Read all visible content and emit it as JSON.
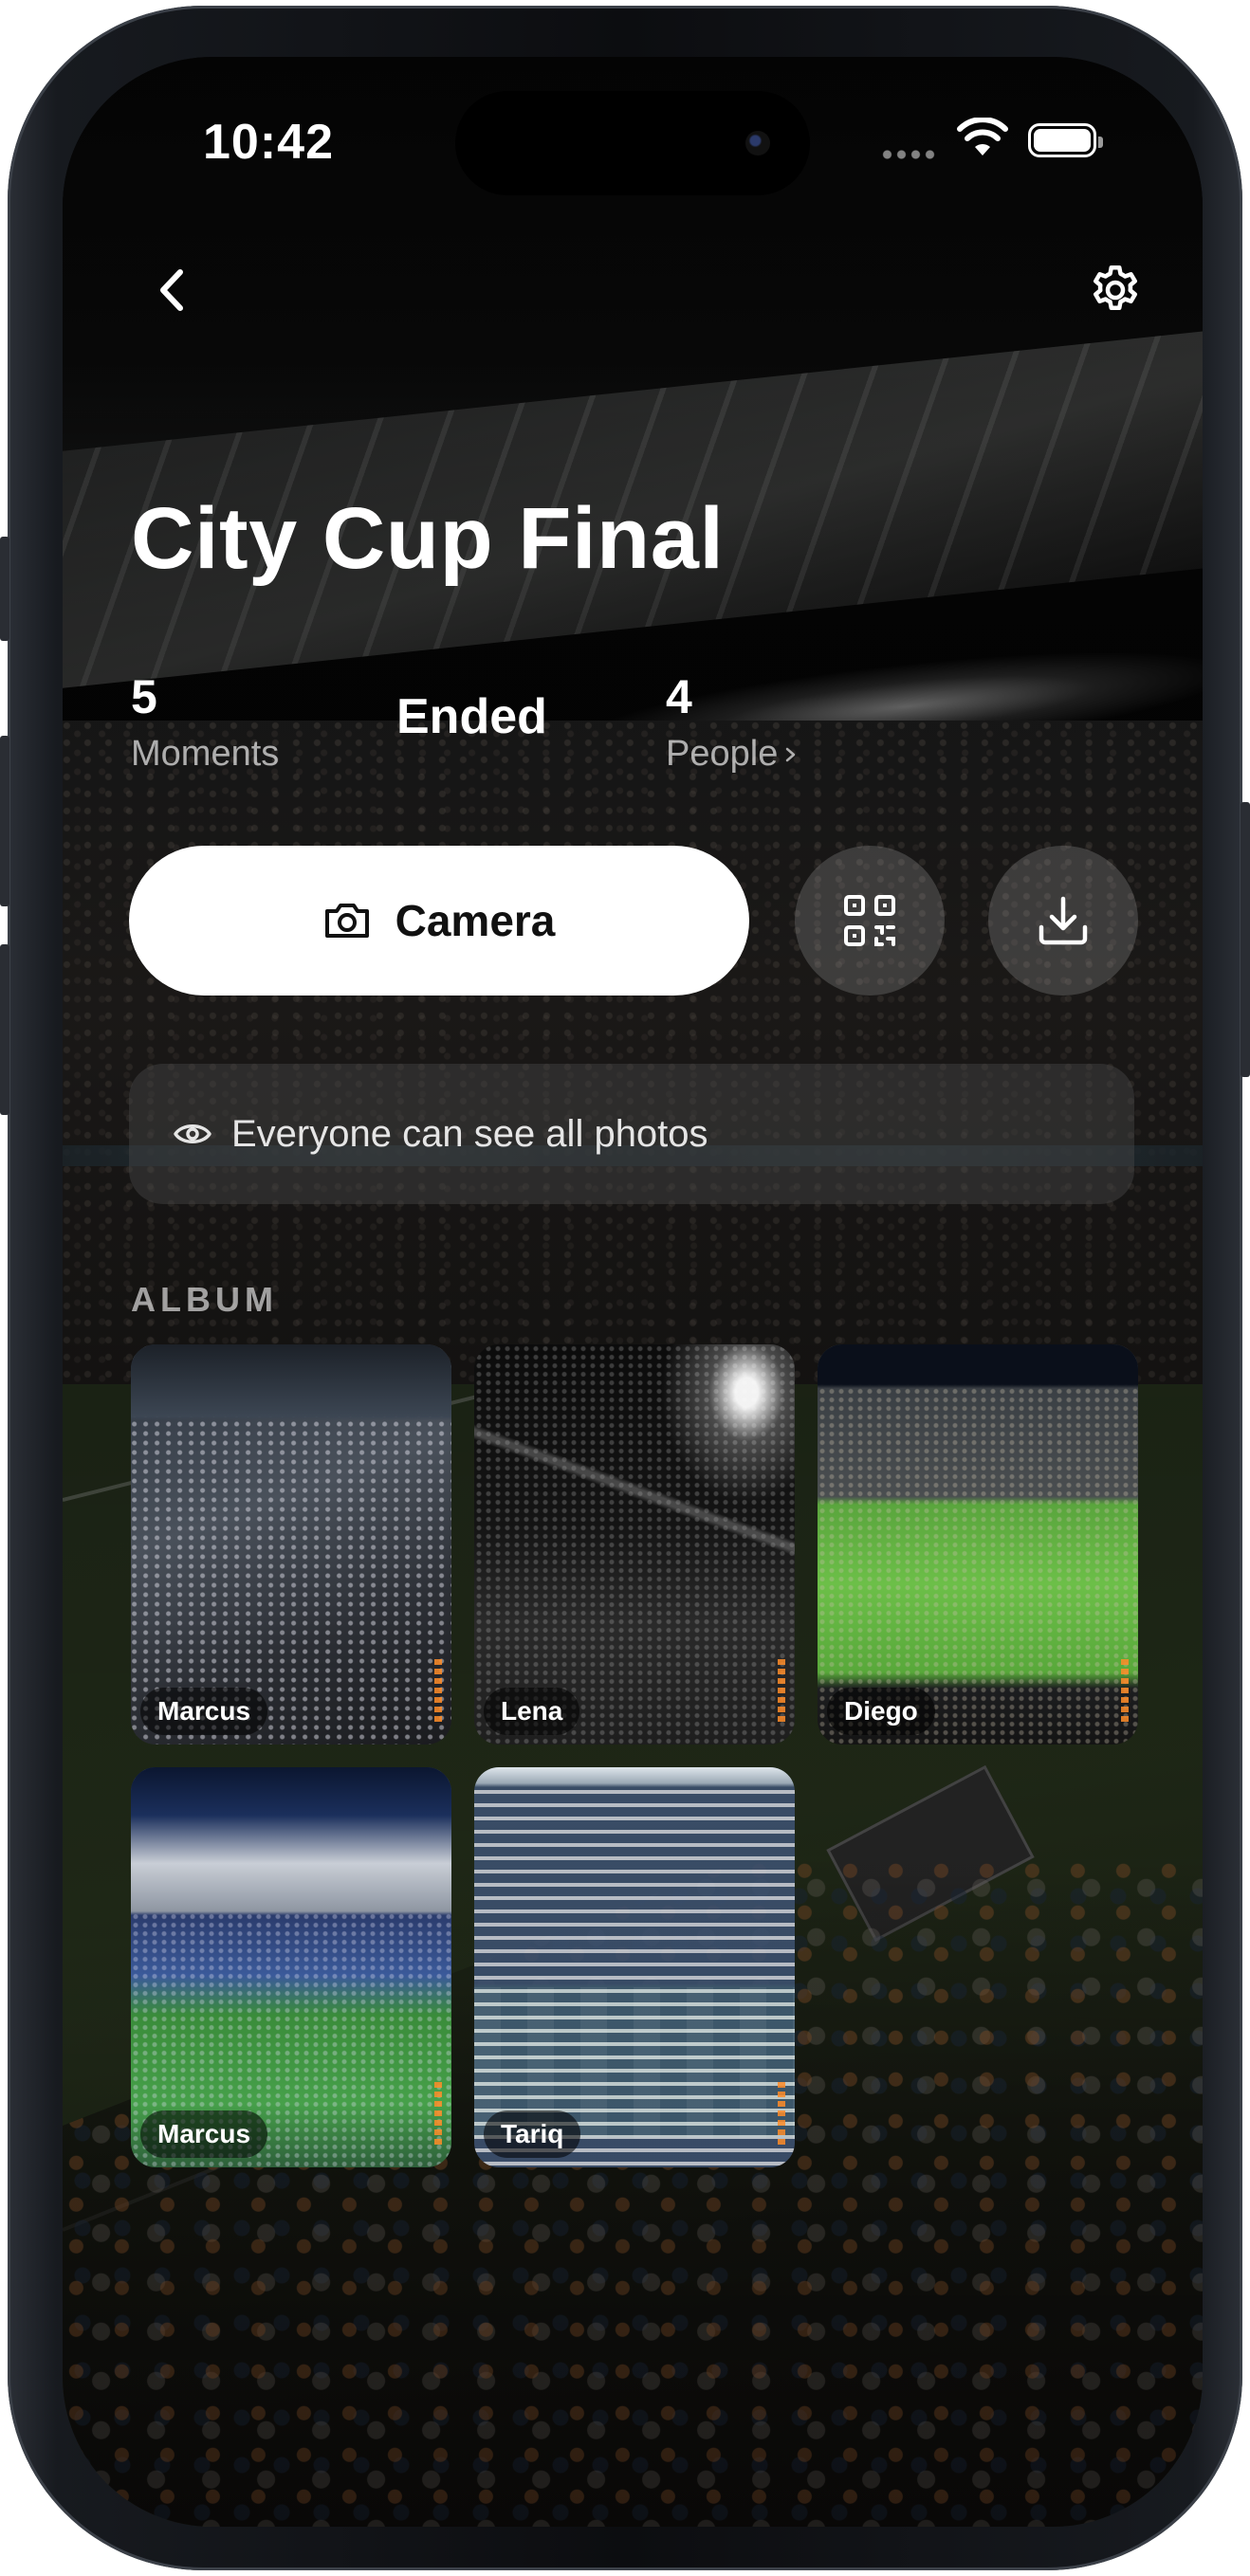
{
  "status_bar": {
    "time": "10:42"
  },
  "event": {
    "title": "City Cup Final",
    "status": "Ended",
    "stats": {
      "moments": {
        "value": "5",
        "label": "Moments"
      },
      "people": {
        "value": "4",
        "label": "People"
      }
    }
  },
  "actions": {
    "camera_label": "Camera"
  },
  "visibility": {
    "text": "Everyone can see all photos"
  },
  "album": {
    "label": "ALBUM",
    "photos": [
      {
        "author": "Marcus"
      },
      {
        "author": "Lena"
      },
      {
        "author": "Diego"
      },
      {
        "author": "Marcus"
      },
      {
        "author": "Tariq"
      }
    ]
  },
  "icons": {
    "back": "chevron-left-icon",
    "settings": "gear-icon",
    "camera": "camera-icon",
    "qr": "qr-code-icon",
    "download": "download-icon",
    "visibility": "eye-icon",
    "people_more": "chevron-right-icon"
  },
  "colors": {
    "primary_button_bg": "#ffffff",
    "primary_button_text": "#111111",
    "text_primary": "#ffffff",
    "text_secondary": "#a6a6a6"
  }
}
